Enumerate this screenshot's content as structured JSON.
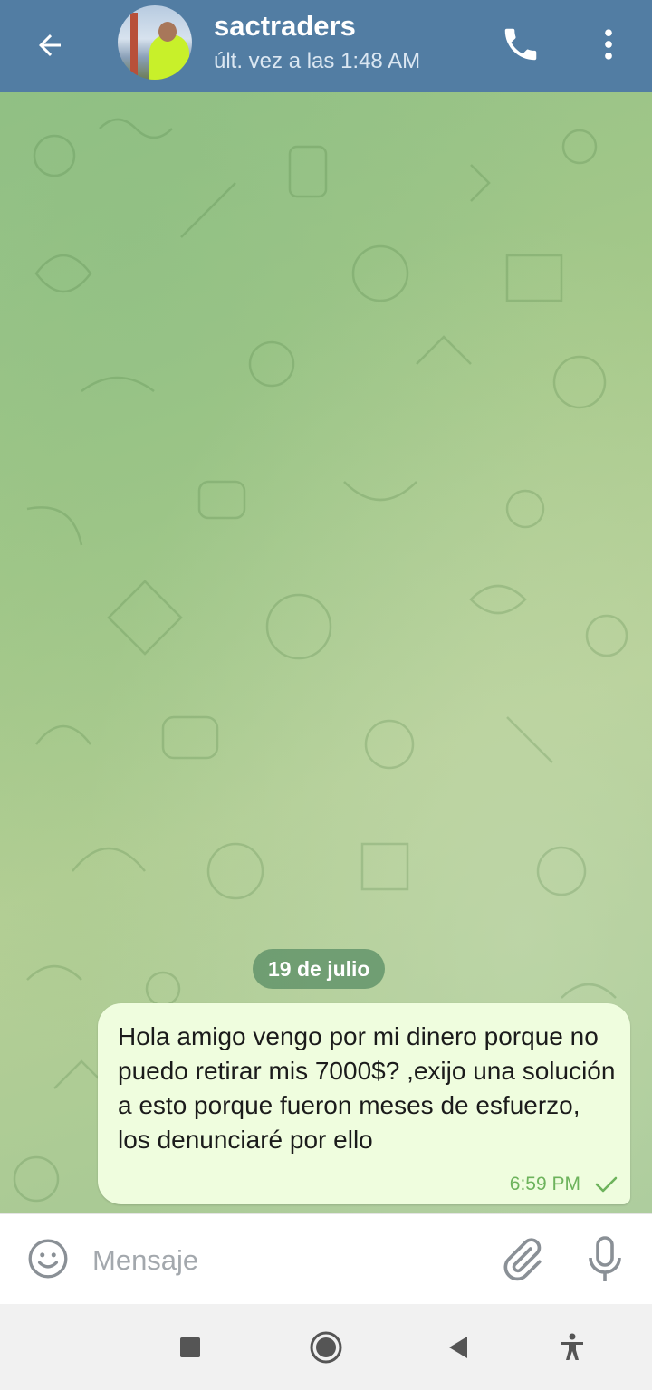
{
  "header": {
    "title": "sactraders",
    "status": "últ. vez a las 1:48 AM",
    "back_icon": "arrow-left-icon",
    "call_icon": "phone-icon",
    "menu_icon": "more-vertical-icon",
    "background_color": "#527da3"
  },
  "chat": {
    "date_separator": "19 de julio",
    "messages": [
      {
        "direction": "outgoing",
        "text": "Hola amigo vengo por mi dinero porque no puedo retirar mis 7000$? ,exijo una solución a esto porque fueron meses de esfuerzo, los denunciaré por ello",
        "time": "6:59 PM",
        "status_icon": "single-check-icon"
      }
    ],
    "bubble_color": "#effdde"
  },
  "composer": {
    "placeholder": "Mensaje",
    "emoji_icon": "smiley-icon",
    "attach_icon": "paperclip-icon",
    "mic_icon": "microphone-icon"
  },
  "navbar": {
    "icons": [
      "recents-square-icon",
      "home-circle-icon",
      "back-triangle-icon",
      "accessibility-icon"
    ]
  }
}
